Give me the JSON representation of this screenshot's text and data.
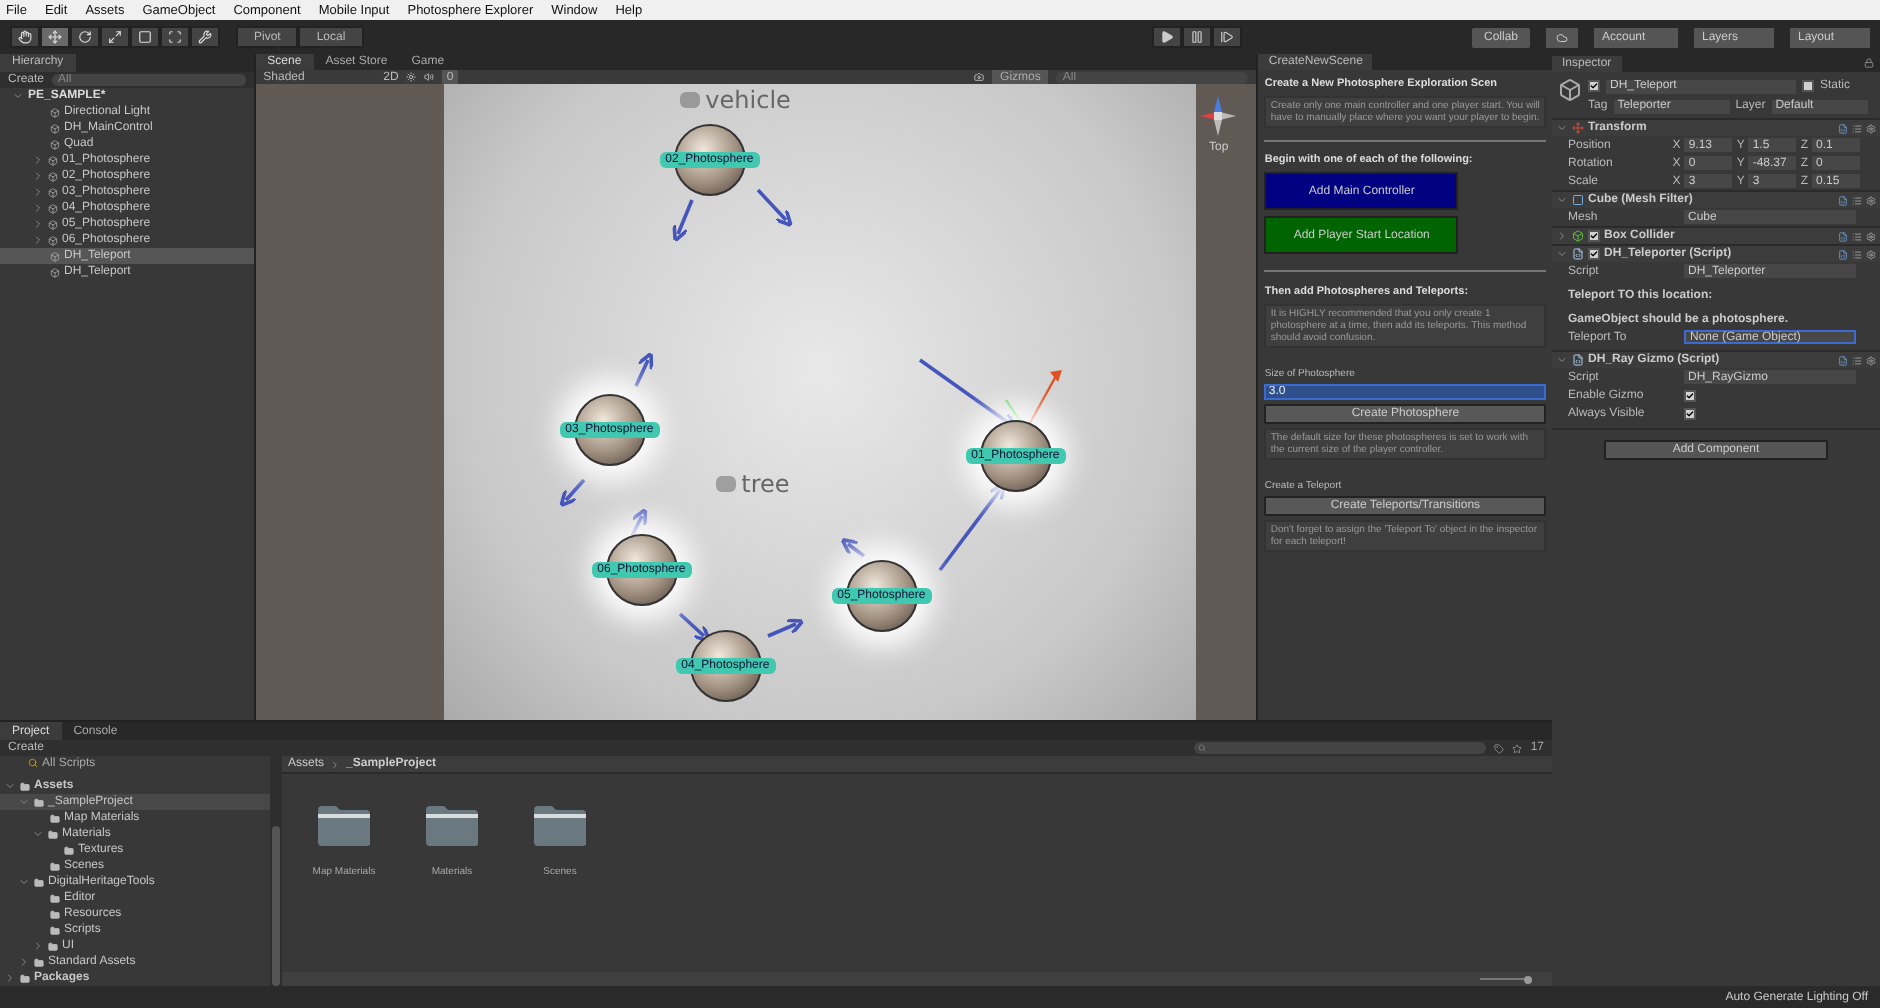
{
  "menu": [
    "File",
    "Edit",
    "Assets",
    "GameObject",
    "Component",
    "Mobile Input",
    "Photosphere Explorer",
    "Window",
    "Help"
  ],
  "toolbar": {
    "tools": [
      {
        "selected": false
      },
      {
        "selected": true
      },
      {
        "selected": false
      },
      {
        "selected": false
      },
      {
        "selected": false
      },
      {
        "selected": false
      },
      {
        "selected": false
      }
    ],
    "pivot": "Pivot",
    "local": "Local",
    "collab": "Collab",
    "account": "Account",
    "layers": "Layers",
    "layout": "Layout"
  },
  "hierarchy": {
    "title": "Hierarchy",
    "create": "Create",
    "search_placeholder": "All",
    "scene": "PE_SAMPLE*",
    "items": [
      {
        "label": "Directional Light",
        "selected": false
      },
      {
        "label": "DH_MainControl",
        "selected": false
      },
      {
        "label": "Quad",
        "selected": false
      },
      {
        "label": "01_Photosphere",
        "selected": false,
        "expanded": false
      },
      {
        "label": "02_Photosphere",
        "selected": false,
        "expanded": false
      },
      {
        "label": "03_Photosphere",
        "selected": false,
        "expanded": false
      },
      {
        "label": "04_Photosphere",
        "selected": false,
        "expanded": false
      },
      {
        "label": "05_Photosphere",
        "selected": false,
        "expanded": false
      },
      {
        "label": "06_Photosphere",
        "selected": false,
        "expanded": false
      },
      {
        "label": "DH_Teleport",
        "selected": true
      },
      {
        "label": "DH_Teleport",
        "selected": false
      }
    ]
  },
  "scene_view": {
    "tabs": [
      {
        "label": "Scene",
        "selected": true
      },
      {
        "label": "Asset Store",
        "selected": false
      },
      {
        "label": "Game",
        "selected": false
      }
    ],
    "shading": "Shaded",
    "mode_2d": "2D",
    "hidden_count": "0",
    "gizmos": "Gizmos",
    "search_placeholder": "All",
    "view_label": "Top",
    "scene_labels": [
      "vehicle",
      "tree"
    ],
    "photospheres": [
      {
        "label": "02_Photosphere",
        "highlighted": false
      },
      {
        "label": "03_Photosphere",
        "highlighted": true
      },
      {
        "label": "01_Photosphere",
        "highlighted": true
      },
      {
        "label": "06_Photosphere",
        "highlighted": true
      },
      {
        "label": "05_Photosphere",
        "highlighted": true
      },
      {
        "label": "04_Photosphere",
        "highlighted": false
      }
    ]
  },
  "create_panel": {
    "title": "CreateNewScene",
    "heading": "Create a New Photosphere Exploration Scen",
    "intro": "Create only one main controller and one player start. You will have to manually place where you want your player to begin.",
    "begin_heading": "Begin with one of each of the following:",
    "start_buttons": [
      {
        "label": "Add Main Controller",
        "color": "#000080"
      },
      {
        "label": "Add Player Start Location",
        "color": "#006400"
      }
    ],
    "then_heading": "Then add Photospheres and Teleports:",
    "recommend": "It is HIGHLY recommended that you only create 1 photosphere at a time, then add its teleports. This method should avoid confusion.",
    "size_label": "Size of Photosphere",
    "size_value": "3.0",
    "create_photosphere": "Create Photosphere",
    "size_note": "The default size for these photospheres is set to work with the current size of the player controller.",
    "teleport_label": "Create a Teleport",
    "create_teleports": "Create Teleports/Transitions",
    "teleport_note": "Don't forget to assign the 'Teleport To' object in the inspector for each teleport!"
  },
  "inspector": {
    "title": "Inspector",
    "name": "DH_Teleport",
    "active": true,
    "static_label": "Static",
    "static": false,
    "tag_label": "Tag",
    "tag": "Teleporter",
    "layer_label": "Layer",
    "layer": "Default",
    "transform": {
      "title": "Transform",
      "expanded": true,
      "rows": [
        {
          "label": "Position",
          "axes": [
            {
              "axis": "X",
              "value": "9.13"
            },
            {
              "axis": "Y",
              "value": "1.5"
            },
            {
              "axis": "Z",
              "value": "0.1"
            }
          ]
        },
        {
          "label": "Rotation",
          "axes": [
            {
              "axis": "X",
              "value": "0"
            },
            {
              "axis": "Y",
              "value": "-48.37"
            },
            {
              "axis": "Z",
              "value": "0"
            }
          ]
        },
        {
          "label": "Scale",
          "axes": [
            {
              "axis": "X",
              "value": "3"
            },
            {
              "axis": "Y",
              "value": "3"
            },
            {
              "axis": "Z",
              "value": "0.15"
            }
          ]
        }
      ]
    },
    "mesh_filter": {
      "title": "Cube (Mesh Filter)",
      "expanded": true,
      "field": "Mesh",
      "value": "Cube"
    },
    "box_collider": {
      "title": "Box Collider",
      "expanded": false,
      "enabled": true
    },
    "teleporter": {
      "title": "DH_Teleporter (Script)",
      "expanded": true,
      "enabled": true,
      "script_label": "Script",
      "script": "DH_Teleporter",
      "note1": "Teleport TO this location:",
      "note2": "GameObject should be a photosphere.",
      "target_label": "Teleport To",
      "target": "None (Game Object)"
    },
    "ray_gizmo": {
      "title": "DH_Ray Gizmo (Script)",
      "expanded": true,
      "script_label": "Script",
      "script": "DH_RayGizmo",
      "toggles": [
        {
          "label": "Enable Gizmo",
          "checked": true
        },
        {
          "label": "Always Visible",
          "checked": true
        }
      ]
    },
    "add_component": "Add Component"
  },
  "project": {
    "tabs": [
      {
        "label": "Project",
        "selected": true
      },
      {
        "label": "Console",
        "selected": false
      }
    ],
    "create": "Create",
    "all_scripts": "All Scripts",
    "count": "17",
    "zoom": {
      "level": 1
    },
    "tree": [
      {
        "label": "Assets",
        "expanded": true,
        "selected": false,
        "children": [
          {
            "label": "_SampleProject",
            "expanded": true,
            "selected": true,
            "children": [
              {
                "label": "Map Materials",
                "selected": false
              },
              {
                "label": "Materials",
                "expanded": true,
                "selected": false,
                "children": [
                  {
                    "label": "Textures",
                    "selected": false
                  }
                ]
              },
              {
                "label": "Scenes",
                "selected": false
              }
            ]
          },
          {
            "label": "DigitalHeritageTools",
            "expanded": true,
            "selected": false,
            "children": [
              {
                "label": "Editor",
                "selected": false
              },
              {
                "label": "Resources",
                "selected": false
              },
              {
                "label": "Scripts",
                "selected": false
              },
              {
                "label": "UI",
                "expanded": false,
                "selected": false
              }
            ]
          },
          {
            "label": "Standard Assets",
            "expanded": false,
            "selected": false
          }
        ]
      },
      {
        "label": "Packages",
        "expanded": false,
        "selected": false
      }
    ],
    "breadcrumb": [
      "Assets",
      "_SampleProject"
    ],
    "folders": [
      "Map Materials",
      "Materials",
      "Scenes"
    ]
  },
  "status": "Auto Generate Lighting Off"
}
